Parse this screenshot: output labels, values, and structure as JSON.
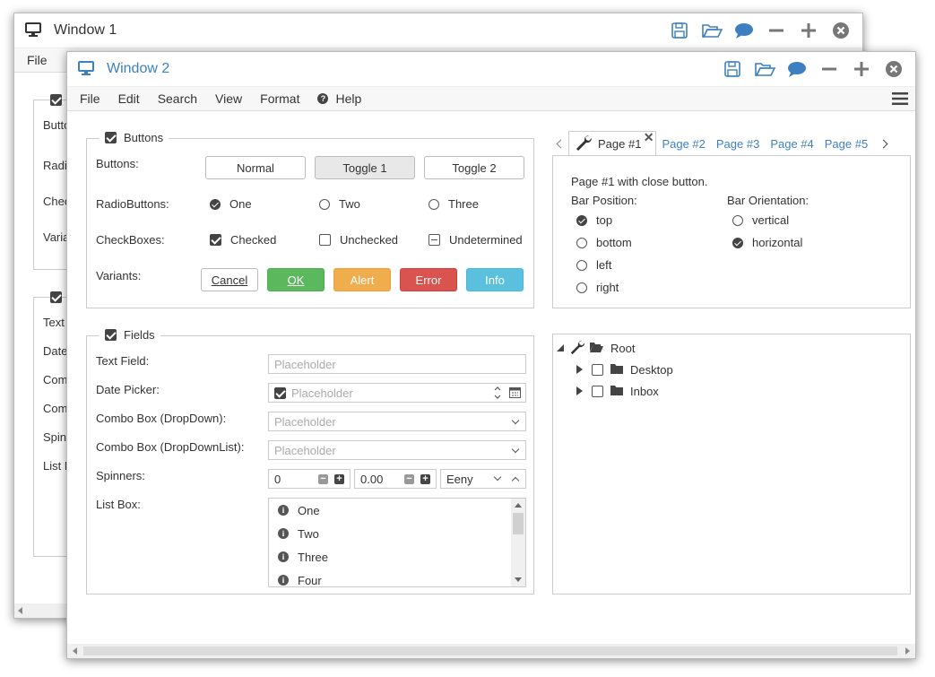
{
  "window1": {
    "title": "Window 1",
    "menu": [
      "File"
    ],
    "clipped_labels": [
      "Butto",
      "Radi",
      "Chec",
      "Varia",
      "Text",
      "Date",
      "Com",
      "Com",
      "Spin",
      "List B"
    ]
  },
  "window2": {
    "title": "Window 2",
    "menu": [
      "File",
      "Edit",
      "Search",
      "View",
      "Format",
      "Help"
    ],
    "buttons_group": {
      "legend": "Buttons",
      "row_buttons_label": "Buttons:",
      "buttons": [
        "Normal",
        "Toggle 1",
        "Toggle 2"
      ],
      "row_radio_label": "RadioButtons:",
      "radios": [
        "One",
        "Two",
        "Three"
      ],
      "row_check_label": "CheckBoxes:",
      "checks": [
        "Checked",
        "Unchecked",
        "Undetermined"
      ],
      "row_variants_label": "Variants:",
      "variants": [
        "Cancel",
        "OK",
        "Alert",
        "Error",
        "Info"
      ]
    },
    "fields_group": {
      "legend": "Fields",
      "text_field_label": "Text Field:",
      "date_picker_label": "Date Picker:",
      "combo_dropdown_label": "Combo Box (DropDown):",
      "combo_dropdownlist_label": "Combo Box (DropDownList):",
      "spinners_label": "Spinners:",
      "listbox_label": "List Box:",
      "placeholder": "Placeholder",
      "spinner1_value": "0",
      "spinner2_value": "0.00",
      "spinner3_value": "Eeny",
      "list_items": [
        "One",
        "Two",
        "Three",
        "Four"
      ]
    },
    "tabs": {
      "items": [
        "Page #1",
        "Page #2",
        "Page #3",
        "Page #4",
        "Page #5"
      ],
      "content_text": "Page #1 with close button.",
      "bar_position_label": "Bar Position:",
      "bar_positions": [
        "top",
        "bottom",
        "left",
        "right"
      ],
      "bar_orientation_label": "Bar Orientation:",
      "bar_orientations": [
        "vertical",
        "horizontal"
      ]
    },
    "tree": {
      "root": "Root",
      "children": [
        "Desktop",
        "Inbox"
      ]
    }
  },
  "colors": {
    "accent": "#3d7fc1",
    "ok": "#5cb85c",
    "alert": "#f0ad4e",
    "error": "#d9534f",
    "info": "#5bc0de"
  }
}
